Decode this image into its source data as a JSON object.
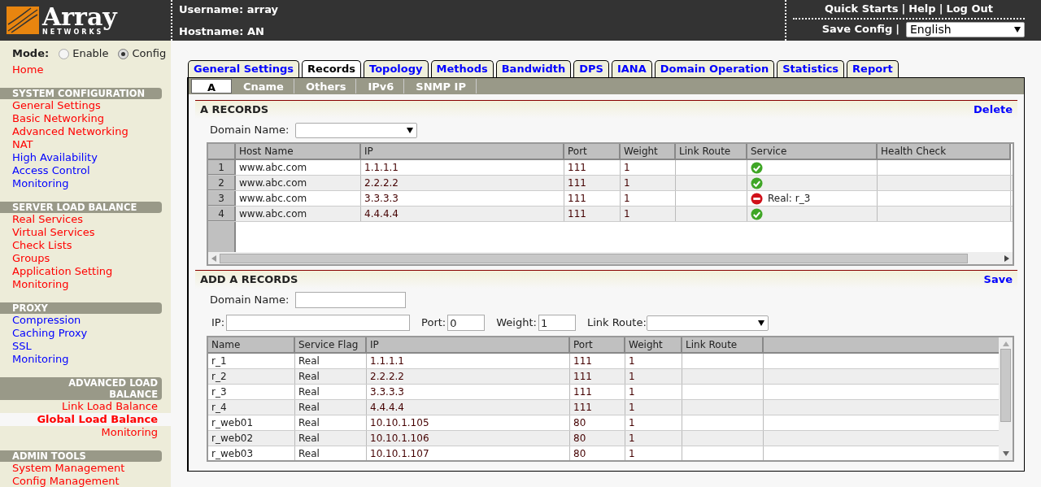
{
  "header": {
    "logo": {
      "name": "Array",
      "tagline": "NETWORKS"
    },
    "username": "Username: array",
    "hostname": "Hostname: AN",
    "links": [
      "Quick Starts",
      "Help",
      "Log Out"
    ],
    "separator": "|",
    "save_config": "Save Config",
    "language": "English"
  },
  "sidebar": {
    "mode": {
      "label": "Mode:",
      "options": [
        {
          "label": "Enable",
          "selected": false
        },
        {
          "label": "Config",
          "selected": true
        }
      ]
    },
    "home": "Home",
    "sections": [
      {
        "title": "SYSTEM CONFIGURATION",
        "expanded": false,
        "items": [
          {
            "label": "General Settings",
            "visited": false,
            "selected": false
          },
          {
            "label": "Basic Networking",
            "visited": false,
            "selected": false
          },
          {
            "label": "Advanced Networking",
            "visited": false,
            "selected": false
          },
          {
            "label": "NAT",
            "visited": false,
            "selected": false
          },
          {
            "label": "High Availability",
            "visited": true,
            "selected": false
          },
          {
            "label": "Access Control",
            "visited": true,
            "selected": false
          },
          {
            "label": "Monitoring",
            "visited": true,
            "selected": false
          }
        ]
      },
      {
        "title": "SERVER LOAD BALANCE",
        "expanded": false,
        "items": [
          {
            "label": "Real Services",
            "visited": false,
            "selected": false
          },
          {
            "label": "Virtual Services",
            "visited": false,
            "selected": false
          },
          {
            "label": "Check Lists",
            "visited": false,
            "selected": false
          },
          {
            "label": "Groups",
            "visited": false,
            "selected": false
          },
          {
            "label": "Application Setting",
            "visited": false,
            "selected": false
          },
          {
            "label": "Monitoring",
            "visited": false,
            "selected": false
          }
        ]
      },
      {
        "title": "PROXY",
        "expanded": false,
        "items": [
          {
            "label": "Compression",
            "visited": true,
            "selected": false
          },
          {
            "label": "Caching Proxy",
            "visited": true,
            "selected": false
          },
          {
            "label": "SSL",
            "visited": true,
            "selected": false
          },
          {
            "label": "Monitoring",
            "visited": true,
            "selected": false
          }
        ]
      },
      {
        "title": "ADVANCED LOAD BALANCE",
        "expanded": true,
        "items": [
          {
            "label": "Link Load Balance",
            "visited": false,
            "selected": false
          },
          {
            "label": "Global Load Balance",
            "visited": false,
            "selected": true
          },
          {
            "label": "Monitoring",
            "visited": false,
            "selected": false
          }
        ]
      },
      {
        "title": "ADMIN TOOLS",
        "expanded": false,
        "items": [
          {
            "label": "System Management",
            "visited": false,
            "selected": false
          },
          {
            "label": "Config Management",
            "visited": false,
            "selected": false
          }
        ]
      }
    ]
  },
  "tabs": [
    {
      "label": "General Settings",
      "selected": false
    },
    {
      "label": "Records",
      "selected": true
    },
    {
      "label": "Topology",
      "selected": false
    },
    {
      "label": "Methods",
      "selected": false
    },
    {
      "label": "Bandwidth",
      "selected": false
    },
    {
      "label": "DPS",
      "selected": false
    },
    {
      "label": "IANA",
      "selected": false
    },
    {
      "label": "Domain Operation",
      "selected": false
    },
    {
      "label": "Statistics",
      "selected": false
    },
    {
      "label": "Report",
      "selected": false
    }
  ],
  "subtabs": [
    {
      "label": "A",
      "selected": true
    },
    {
      "label": "Cname",
      "selected": false
    },
    {
      "label": "Others",
      "selected": false
    },
    {
      "label": "IPv6",
      "selected": false
    },
    {
      "label": "SNMP IP",
      "selected": false
    }
  ],
  "a_records": {
    "title": "A RECORDS",
    "action": "Delete",
    "domain_label": "Domain Name:",
    "columns": [
      "Host Name",
      "IP",
      "Port",
      "Weight",
      "Link Route",
      "Service",
      "Health Check"
    ],
    "rows": [
      {
        "num": "1",
        "host": "www.abc.com",
        "ip": "1.1.1.1",
        "port": "111",
        "weight": "1",
        "service": {
          "ok": true
        }
      },
      {
        "num": "2",
        "host": "www.abc.com",
        "ip": "2.2.2.2",
        "port": "111",
        "weight": "1",
        "service": {
          "ok": true
        }
      },
      {
        "num": "3",
        "host": "www.abc.com",
        "ip": "3.3.3.3",
        "port": "111",
        "weight": "1",
        "service": {
          "ok": false,
          "text": "Real: r_3"
        }
      },
      {
        "num": "4",
        "host": "www.abc.com",
        "ip": "4.4.4.4",
        "port": "111",
        "weight": "1",
        "service": {
          "ok": true
        }
      }
    ]
  },
  "add_records": {
    "title": "ADD A RECORDS",
    "action": "Save",
    "domain_label": "Domain Name:",
    "ip_label": "IP:",
    "port_label": "Port:",
    "port_value": "0",
    "weight_label": "Weight:",
    "weight_value": "1",
    "link_route_label": "Link Route:",
    "columns": [
      "Name",
      "Service Flag",
      "IP",
      "Port",
      "Weight",
      "Link Route"
    ],
    "rows": [
      [
        "r_1",
        "Real",
        "1.1.1.1",
        "111",
        "1"
      ],
      [
        "r_2",
        "Real",
        "2.2.2.2",
        "111",
        "1"
      ],
      [
        "r_3",
        "Real",
        "3.3.3.3",
        "111",
        "1"
      ],
      [
        "r_4",
        "Real",
        "4.4.4.4",
        "111",
        "1"
      ],
      [
        "r_web01",
        "Real",
        "10.10.1.105",
        "80",
        "1"
      ],
      [
        "r_web02",
        "Real",
        "10.10.1.106",
        "80",
        "1"
      ],
      [
        "r_web03",
        "Real",
        "10.10.1.107",
        "80",
        "1"
      ]
    ]
  }
}
